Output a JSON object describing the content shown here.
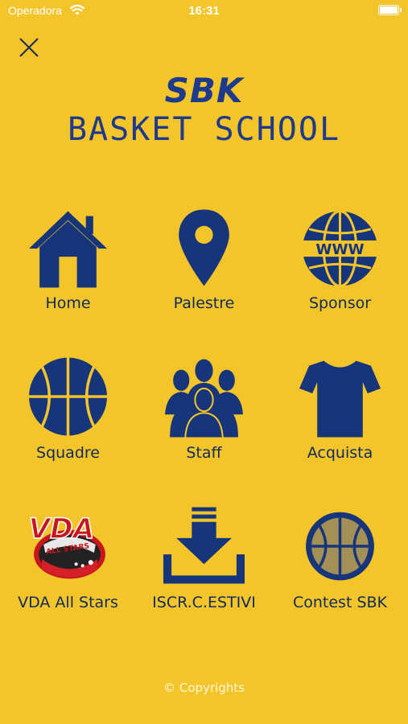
{
  "status_bar": {
    "carrier": "Operadora",
    "time": "16:31"
  },
  "logo": {
    "top_text": "SBK",
    "bottom_text": "BASKET SCHOOL"
  },
  "menu": [
    {
      "label": "Home",
      "icon": "home-icon"
    },
    {
      "label": "Palestre",
      "icon": "location-pin-icon"
    },
    {
      "label": "Sponsor",
      "icon": "globe-www-icon"
    },
    {
      "label": "Squadre",
      "icon": "basketball-icon"
    },
    {
      "label": "Staff",
      "icon": "staff-group-icon"
    },
    {
      "label": "Acquista",
      "icon": "tshirt-icon"
    },
    {
      "label": "VDA All Stars",
      "icon": "vda-all-stars-logo"
    },
    {
      "label": "ISCR.C.ESTIVI",
      "icon": "download-icon"
    },
    {
      "label": "Contest SBK",
      "icon": "basketball-contest-icon"
    }
  ],
  "footer": {
    "copyright": "© Copyrights"
  },
  "colors": {
    "background": "#F4C52A",
    "icon": "#16357A",
    "label": "#102A5A"
  }
}
